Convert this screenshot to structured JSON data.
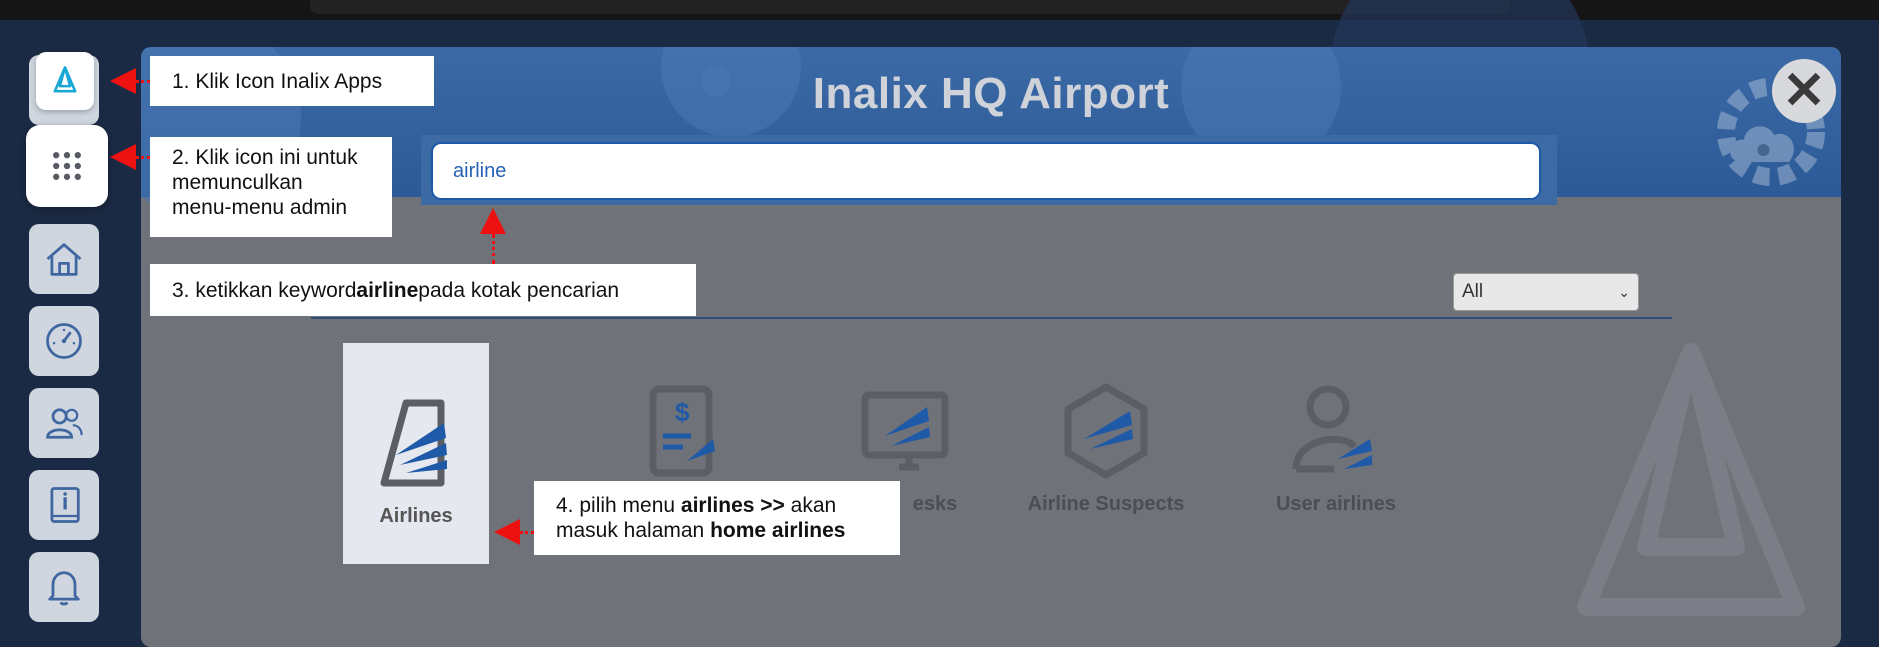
{
  "modal": {
    "title": "Inalix HQ Airport",
    "close_label": "✕",
    "search": {
      "value": "airline"
    },
    "filter": {
      "selected": "All"
    }
  },
  "apps": [
    {
      "label": "Airlines",
      "icon": "airlines-icon"
    },
    {
      "label": "Airline Desks",
      "icon": "airline-desks-icon"
    },
    {
      "label": "Airline Suspects",
      "icon": "airline-suspects-icon"
    },
    {
      "label": "User airlines",
      "icon": "user-airlines-icon"
    }
  ],
  "apps_partial": {
    "billing_label": "",
    "desks_label_visible": "esks"
  },
  "sidebar": {
    "items": [
      {
        "icon": "inalix-apps-icon"
      },
      {
        "icon": "apps-grid-icon"
      },
      {
        "icon": "home-icon"
      },
      {
        "icon": "dashboard-gauge-icon"
      },
      {
        "icon": "users-icon"
      },
      {
        "icon": "info-book-icon"
      },
      {
        "icon": "bell-icon"
      }
    ]
  },
  "annotations": {
    "step1": "1. Klik Icon Inalix Apps",
    "step2_line1": "2. Klik icon ini untuk",
    "step2_line2": "memunculkan",
    "step2_line3": "menu-menu admin",
    "step3_pre": "3. ketikkan keyword ",
    "step3_bold": "airline",
    "step3_post": " pada kotak pencarian",
    "step4_pre": "4. pilih menu ",
    "step4_bold1": "airlines >>",
    "step4_mid": " akan",
    "step4_line2_pre": "masuk halaman ",
    "step4_bold2": "home airlines"
  },
  "colors": {
    "accent": "#1e5aa8",
    "annotation_arrow": "#e11111",
    "modal_bg": "#6f7279"
  }
}
